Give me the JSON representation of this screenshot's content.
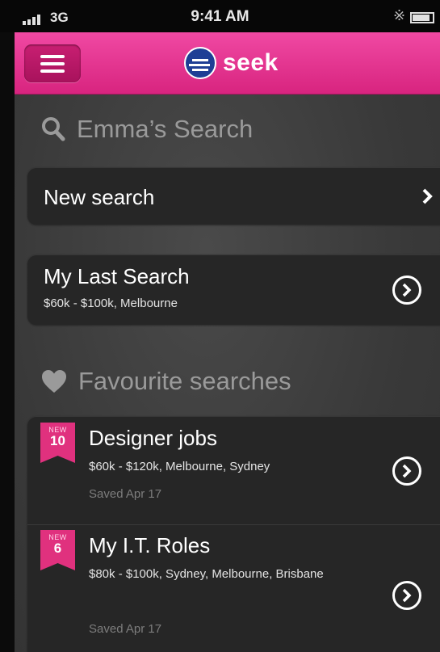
{
  "status_bar": {
    "carrier": "3G",
    "time": "9:41 AM"
  },
  "nav": {
    "logo_text": "seek"
  },
  "search_section": {
    "title": "Emma’s Search"
  },
  "new_search": {
    "label": "New search"
  },
  "last_search": {
    "title": "My Last Search",
    "details": "$60k - $100k, Melbourne"
  },
  "favourites_section": {
    "title": "Favourite searches"
  },
  "favourites": [
    {
      "badge_label": "NEW",
      "badge_count": "10",
      "title": "Designer jobs",
      "details": "$60k - $120k, Melbourne, Sydney",
      "saved": "Saved Apr 17"
    },
    {
      "badge_label": "NEW",
      "badge_count": "6",
      "title": "My I.T. Roles",
      "details": "$80k - $100k, Sydney, Melbourne, Brisbane",
      "saved": "Saved Apr 17"
    }
  ],
  "colors": {
    "brand_pink": "#e0317e",
    "nav_pink": "#f049a3",
    "logo_blue": "#1f3e95",
    "card_bg": "#262626"
  },
  "icons": [
    "signal-icon",
    "bluetooth-icon",
    "battery-icon",
    "menu-icon",
    "seek-logo-icon",
    "search-icon",
    "heart-icon",
    "chevron-right-icon",
    "chevron-circle-icon"
  ]
}
